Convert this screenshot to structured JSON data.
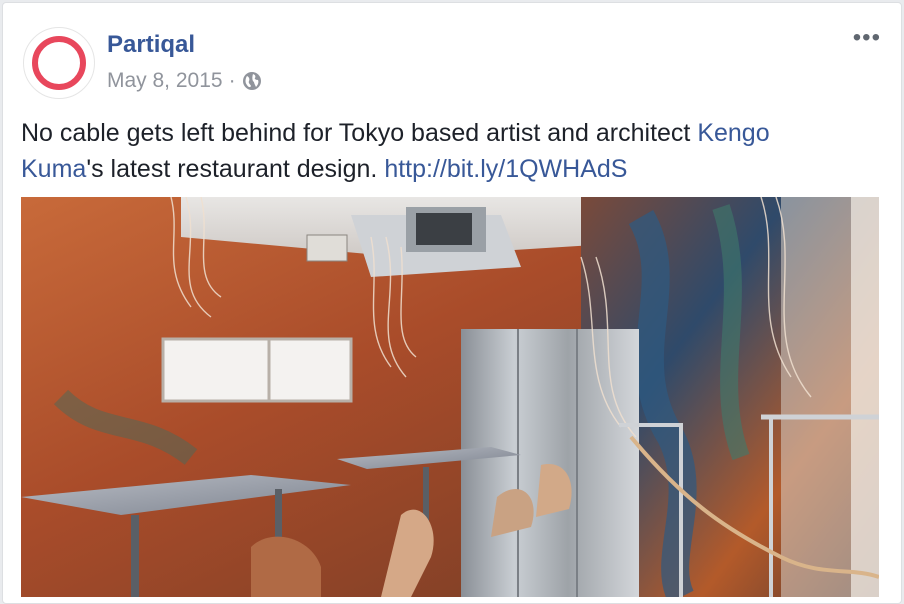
{
  "post": {
    "page_name": "Partiqal",
    "date": "May 8, 2015",
    "dot": "·",
    "more_label": "•••",
    "caption": {
      "before": "No cable gets left behind for Tokyo based artist and architect ",
      "mention": "Kengo Kuma",
      "middle": "'s latest restaurant design. ",
      "link": "http://bit.ly/1QWHAdS"
    }
  },
  "colors": {
    "link": "#385898",
    "meta": "#90949c",
    "avatar_ring": "#e8475c"
  },
  "icons": {
    "privacy": "globe-icon",
    "avatar": "ring-logo",
    "menu": "more-options-icon"
  }
}
